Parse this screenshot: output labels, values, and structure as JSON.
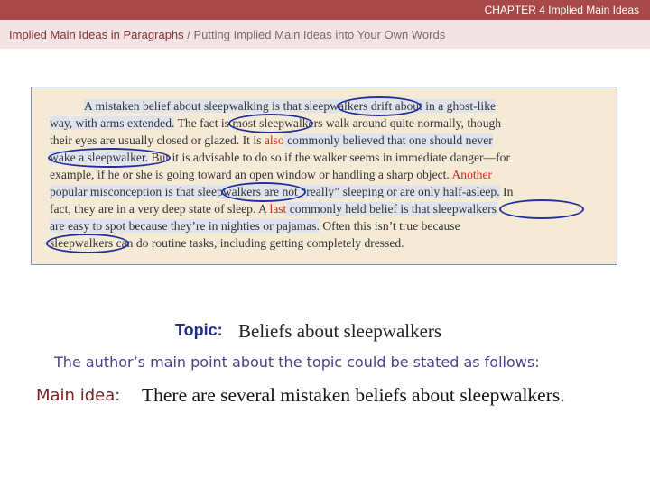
{
  "header": {
    "chapter": "CHAPTER 4   Implied Main Ideas",
    "breadcrumb_main": "Implied Main Ideas in Paragraphs",
    "breadcrumb_sep": " / ",
    "breadcrumb_sub": "Putting Implied Main Ideas into Your Own Words"
  },
  "passage": {
    "l1a": "A mistaken belief about sleepwalking is that sleepwalkers drift about in a ghost-like",
    "l2a": "way, with arms extended.",
    "l2b": " The fact is most sleepwalkers walk around quite normally, though",
    "l3a": "their eyes are usually closed or glazed. It is ",
    "l3b": "also",
    "l3c": " commonly believed that one should never",
    "l4a": "wake a sleepwalker.",
    "l4b": " But it is advisable to do so if the walker seems in immediate danger—for",
    "l5a": "example, if he or she is going toward an open window or handling a sharp object. ",
    "l5b": "Another",
    "l6a": "popular misconception is that sleepwalkers are not “really” sleeping or are only half-asleep.",
    "l6b": " In",
    "l7a": "fact, they are in a very deep state of sleep. A ",
    "l7b": "last",
    "l7c": " commonly held belief is that sleepwalkers",
    "l8a": "are easy to spot because they’re in nighties or pajamas.",
    "l8b": " Often this isn’t true because",
    "l9a": "sleepwalkers can do routine tasks, including getting completely dressed."
  },
  "topic": {
    "label": "Topic:",
    "text": "Beliefs about sleepwalkers"
  },
  "author_line": "The author’s main point about the topic could be stated as follows:",
  "main_idea": {
    "label": "Main idea:",
    "text": "There are several mistaken beliefs about sleepwalkers."
  }
}
